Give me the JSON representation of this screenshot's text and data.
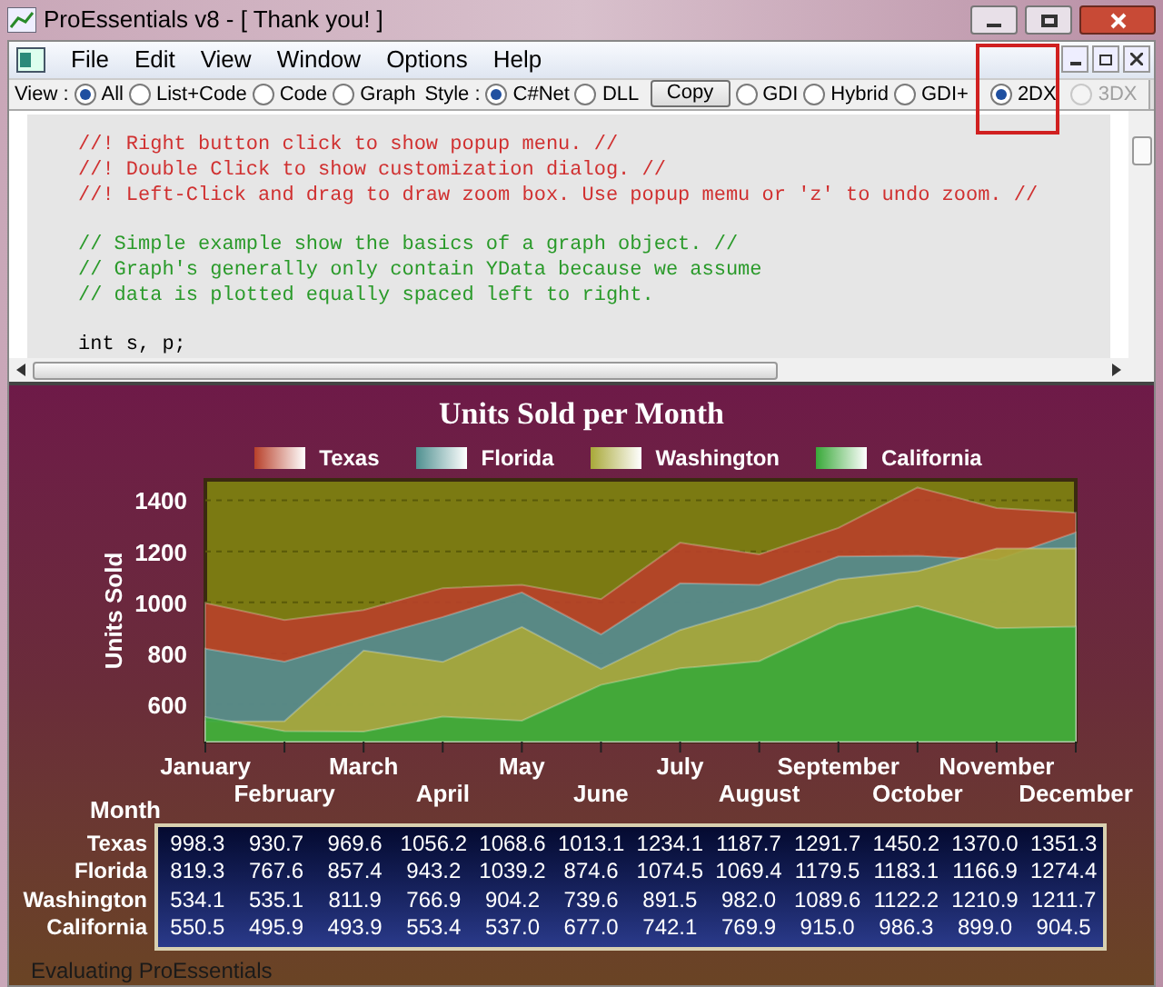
{
  "window": {
    "title": "ProEssentials v8 - [ Thank you! ]"
  },
  "menu": [
    "File",
    "Edit",
    "View",
    "Window",
    "Options",
    "Help"
  ],
  "toolbar": {
    "view_label": "View :",
    "view_options": [
      {
        "label": "All",
        "selected": true
      },
      {
        "label": "List+Code",
        "selected": false
      },
      {
        "label": "Code",
        "selected": false
      },
      {
        "label": "Graph",
        "selected": false
      }
    ],
    "style_label": "Style :",
    "style_options": [
      {
        "label": "C#Net",
        "selected": true
      },
      {
        "label": "DLL",
        "selected": false
      }
    ],
    "copy_button": "Copy",
    "render_options": [
      {
        "label": "GDI",
        "selected": false,
        "disabled": false
      },
      {
        "label": "Hybrid",
        "selected": false,
        "disabled": false
      },
      {
        "label": "GDI+",
        "selected": false,
        "disabled": false
      },
      {
        "label": "2DX",
        "selected": true,
        "disabled": false,
        "highlighted": true
      },
      {
        "label": "3DX",
        "selected": false,
        "disabled": true
      }
    ]
  },
  "code_blocks": [
    {
      "kind": "directive",
      "lines": [
        "//! Right button click to show popup menu. //",
        "//! Double Click to show customization dialog. //",
        "//! Left-Click and drag to draw zoom box. Use popup memu or 'z' to undo zoom. //"
      ]
    },
    {
      "kind": "comment",
      "lines": [
        "// Simple example show the basics of a graph object. //",
        "// Graph's generally only contain YData because we assume",
        "// data is plotted equally spaced left to right."
      ]
    },
    {
      "kind": "code",
      "lines": [
        "int s, p;"
      ]
    }
  ],
  "chart": {
    "chart_data": {
      "type": "area",
      "title": "Units Sold per Month",
      "xlabel": "Month",
      "ylabel": "Units Sold",
      "categories": [
        "January",
        "February",
        "March",
        "April",
        "May",
        "June",
        "July",
        "August",
        "September",
        "October",
        "November",
        "December"
      ],
      "ylim": [
        455,
        1480
      ],
      "yticks": [
        600,
        800,
        1000,
        1200,
        1400
      ],
      "stacked": false,
      "grid": true,
      "series": [
        {
          "name": "Texas",
          "color": "#b8402a",
          "values": [
            998,
            931,
            970,
            1056,
            1069,
            1013,
            1234,
            1188,
            1292,
            1450,
            1370,
            1351
          ]
        },
        {
          "name": "Florida",
          "color": "#4f9090",
          "values": [
            819,
            768,
            857,
            943,
            1039,
            875,
            1075,
            1069,
            1180,
            1183,
            1167,
            1274
          ]
        },
        {
          "name": "Washington",
          "color": "#a8a838",
          "values": [
            534,
            535,
            812,
            767,
            904,
            740,
            892,
            982,
            1090,
            1122,
            1211,
            1212
          ]
        },
        {
          "name": "California",
          "color": "#38a838",
          "values": [
            551,
            496,
            494,
            553,
            537,
            677,
            742,
            770,
            915,
            986,
            899,
            905
          ]
        }
      ]
    },
    "table_rows": [
      {
        "label": "Texas",
        "values": [
          "998.3",
          "930.7",
          "969.6",
          "1056.2",
          "1068.6",
          "1013.1",
          "1234.1",
          "1187.7",
          "1291.7",
          "1450.2",
          "1370.0",
          "1351.3"
        ]
      },
      {
        "label": "Florida",
        "values": [
          "819.3",
          "767.6",
          "857.4",
          "943.2",
          "1039.2",
          "874.6",
          "1074.5",
          "1069.4",
          "1179.5",
          "1183.1",
          "1166.9",
          "1274.4"
        ]
      },
      {
        "label": "Washington",
        "values": [
          "534.1",
          "535.1",
          "811.9",
          "766.9",
          "904.2",
          "739.6",
          "891.5",
          "982.0",
          "1089.6",
          "1122.2",
          "1210.9",
          "1211.7"
        ]
      },
      {
        "label": "California",
        "values": [
          "550.5",
          "495.9",
          "493.9",
          "553.4",
          "537.0",
          "677.0",
          "742.1",
          "769.9",
          "915.0",
          "986.3",
          "899.0",
          "904.5"
        ]
      }
    ],
    "footer": "Evaluating ProEssentials"
  }
}
